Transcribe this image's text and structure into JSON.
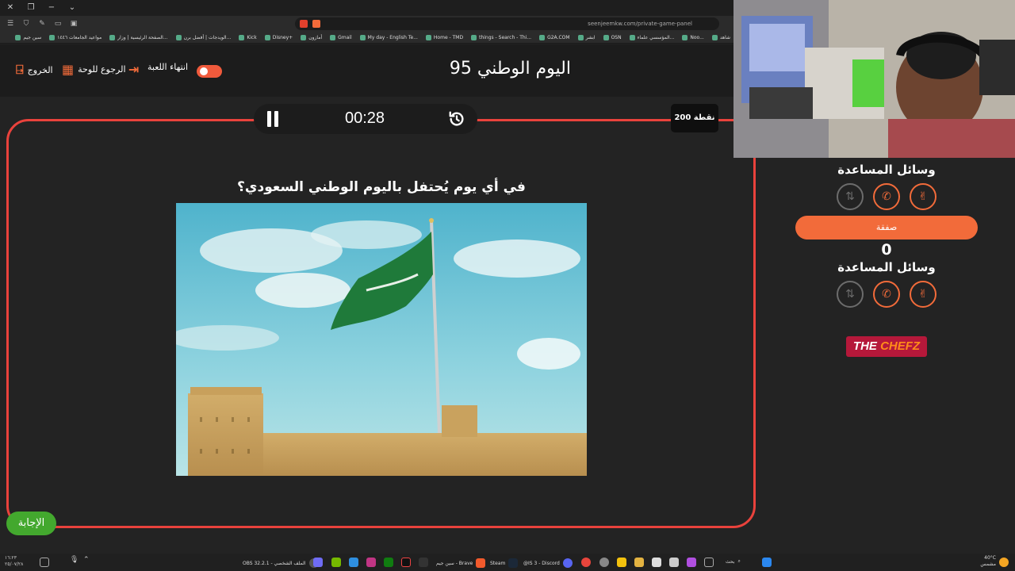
{
  "browser": {
    "url": "seenjeemkw.com/private-game-panel",
    "bookmarks": [
      "سين جيم",
      "مواعيد الجامعات ١٤٤٦",
      "الصفحة الرئيسية | وزار...",
      "الويدجات | أفضل برن...",
      "Kick",
      "Disney+",
      "أمازون",
      "Gmail",
      "My day - English Te...",
      "Home - TMD",
      "things - Search - Thi...",
      "G2A.COM",
      "ابشر",
      "OSN",
      "المؤسسي علماء...",
      "Noo...",
      "شاهد"
    ]
  },
  "header": {
    "title": "اليوم الوطني 95",
    "end_game": "انتهاء اللعبة",
    "back_to_board": "الرجوع للوحة",
    "exit": "الخروج"
  },
  "timer": {
    "time": "00:28"
  },
  "points": "200 نقطة",
  "question": {
    "text": "في أي يوم يُحتفل باليوم الوطني السعودي؟"
  },
  "answer_button": "الإجابة",
  "panel": {
    "aids_title_1": "وسائل المساعدة",
    "deal_button": "صفقة",
    "score": "0",
    "aids_title_2": "وسائل المساعدة",
    "sponsor": {
      "the": "THE",
      "chefz": "CHEFZ"
    }
  },
  "taskbar": {
    "weather": "40°C",
    "weather_sub": "مشمس",
    "apps": [
      "OBS 32.2.1 - الملف الشخصي",
      "سين جيم - Brave",
      "Steam",
      "@IS 3 - Discord"
    ],
    "search": "بحث",
    "time": "١٦:٢٣",
    "date": "٢٥/٠٧/٢٨"
  }
}
